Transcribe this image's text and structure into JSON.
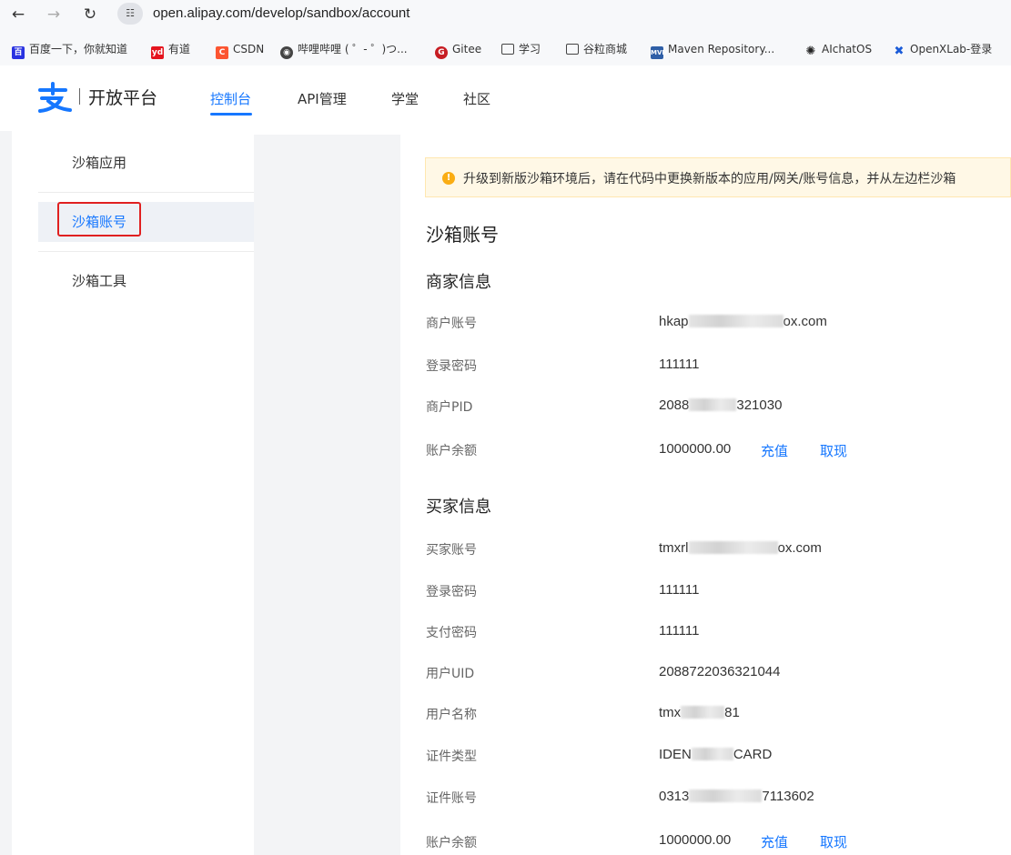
{
  "browser": {
    "url": "open.alipay.com/develop/sandbox/account",
    "bookmarks": [
      {
        "label": "百度一下，你就知道",
        "icon": "baidu-icon",
        "color": "#2932e1"
      },
      {
        "label": "有道",
        "icon": "youdao-icon",
        "color": "#e5141e"
      },
      {
        "label": "CSDN",
        "icon": "csdn-icon",
        "color": "#fc5531"
      },
      {
        "label": "哔哩哔哩 ( ゜- ゜)つ...",
        "icon": "bilibili-icon",
        "color": "#444444"
      },
      {
        "label": "Gitee",
        "icon": "gitee-icon",
        "color": "#c71d23"
      },
      {
        "label": "学习",
        "icon": "folder-icon",
        "color": "#444444"
      },
      {
        "label": "谷粒商城",
        "icon": "folder-icon",
        "color": "#444444"
      },
      {
        "label": "Maven Repository...",
        "icon": "maven-icon",
        "color": "#2f5fa7"
      },
      {
        "label": "AIchatOS",
        "icon": "openai-icon",
        "color": "#222222"
      },
      {
        "label": "OpenXLab-登录",
        "icon": "openxlab-icon",
        "color": "#1a5bd8"
      }
    ]
  },
  "header": {
    "brand": "开放平台",
    "tabs": [
      {
        "label": "控制台",
        "active": true
      },
      {
        "label": "API管理",
        "active": false
      },
      {
        "label": "学堂",
        "active": false
      },
      {
        "label": "社区",
        "active": false
      }
    ]
  },
  "sidebar": {
    "items": [
      {
        "label": "沙箱应用",
        "active": false
      },
      {
        "label": "沙箱账号",
        "active": true
      },
      {
        "label": "沙箱工具",
        "active": false
      }
    ]
  },
  "alert": {
    "text": "升级到新版沙箱环境后，请在代码中更换新版本的应用/网关/账号信息，并从左边栏沙箱"
  },
  "main": {
    "title": "沙箱账号",
    "merchant": {
      "title": "商家信息",
      "account_label": "商户账号",
      "account_prefix": "hkap",
      "account_suffix": "ox.com",
      "password_label": "登录密码",
      "password": "111111",
      "pid_label": "商户PID",
      "pid_prefix": "2088",
      "pid_suffix": "321030",
      "balance_label": "账户余额",
      "balance": "1000000.00",
      "recharge": "充值",
      "withdraw": "取现"
    },
    "buyer": {
      "title": "买家信息",
      "account_label": "买家账号",
      "account_prefix": "tmxrl",
      "account_suffix": "ox.com",
      "password_label": "登录密码",
      "password": "111111",
      "pay_password_label": "支付密码",
      "pay_password": "111111",
      "uid_label": "用户UID",
      "uid": "2088722036321044",
      "name_label": "用户名称",
      "name_prefix": "tmx",
      "name_suffix": "81",
      "id_type_label": "证件类型",
      "id_type_prefix": "IDEN",
      "id_type_suffix": "CARD",
      "id_no_label": "证件账号",
      "id_no_prefix": "0313",
      "id_no_suffix": "7113602",
      "balance_label": "账户余额",
      "balance": "1000000.00",
      "recharge": "充值",
      "withdraw": "取现"
    }
  }
}
